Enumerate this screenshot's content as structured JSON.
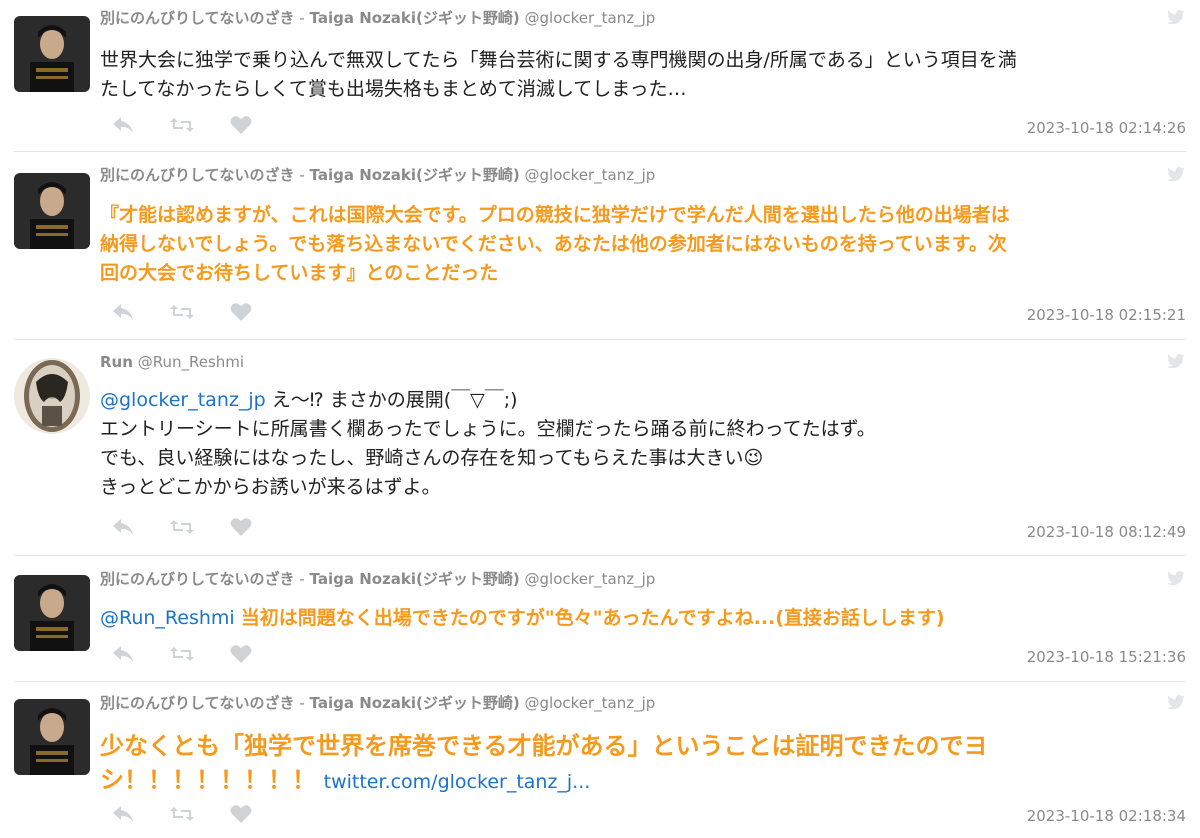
{
  "tweets": [
    {
      "display_name": "別にのんびりしてないのざき",
      "separator": "-",
      "real_name": "Taiga Nozaki(ジギット野崎)",
      "handle": "@glocker_tanz_jp",
      "text_line1": "世界大会に独学で乗り込んで無双してたら「舞台芸術に関する専門機関の出身/所属である」という項目を満",
      "text_line2": "たしてなかったらしくて賞も出場失格もまとめて消滅してしまった…",
      "timestamp": "2023-10-18 02:14:26"
    },
    {
      "display_name": "別にのんびりしてないのざき",
      "separator": "-",
      "real_name": "Taiga Nozaki(ジギット野崎)",
      "handle": "@glocker_tanz_jp",
      "text_line1": "『才能は認めますが、これは国際大会です。プロの競技に独学だけで学んだ人間を選出したら他の出場者は",
      "text_line2": "納得しないでしょう。でも落ち込まないでください、あなたは他の参加者にはないものを持っています。次",
      "text_line3": "回の大会でお待ちしています』とのことだった",
      "timestamp": "2023-10-18 02:15:21"
    },
    {
      "display_name": "Run",
      "handle": "@Run_Reshmi",
      "mention": "@glocker_tanz_jp",
      "text_line1_rest": " え〜⁉︎ まさかの展開(￣▽￣;)",
      "text_line2": "エントリーシートに所属書く欄あったでしょうに。空欄だったら踊る前に終わってたはず。",
      "text_line3": "でも、良い経験にはなったし、野崎さんの存在を知ってもらえた事は大きい😉",
      "text_line4": "きっとどこかからお誘いが来るはずよ。",
      "timestamp": "2023-10-18 08:12:49"
    },
    {
      "display_name": "別にのんびりしてないのざき",
      "separator": "-",
      "real_name": "Taiga Nozaki(ジギット野崎)",
      "handle": "@glocker_tanz_jp",
      "mention": "@Run_Reshmi",
      "text_line1_rest": "当初は問題なく出場できたのですが\"色々\"あったんですよね...(直接お話しします)",
      "timestamp": "2023-10-18 15:21:36"
    },
    {
      "display_name": "別にのんびりしてないのざき",
      "separator": "-",
      "real_name": "Taiga Nozaki(ジギット野崎)",
      "handle": "@glocker_tanz_jp",
      "text_line1": "少なくとも「独学で世界を席巻できる才能がある」ということは証明できたのでヨ",
      "text_line2": "シ！！！！！！！！",
      "link": "twitter.com/glocker_tanz_j...",
      "timestamp": "2023-10-18 02:18:34"
    }
  ],
  "icons": {
    "reply": "reply-icon",
    "retweet": "retweet-icon",
    "like": "heart-icon",
    "bird": "twitter-bird-icon"
  },
  "colors": {
    "highlight": "#f59a1d",
    "link": "#1a73c9",
    "meta": "#8a8a8a"
  }
}
